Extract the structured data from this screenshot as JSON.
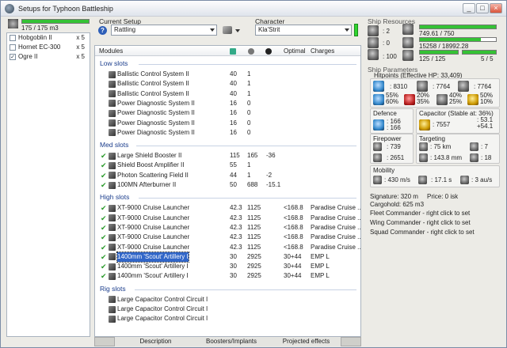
{
  "window": {
    "title": "Setups for Typhoon Battleship",
    "btn_min": "_",
    "btn_max": "□",
    "btn_close": "×"
  },
  "left": {
    "capacity": "175 / 175 m3",
    "capacity_fill": 1.0,
    "drones": [
      {
        "name": "Hobgoblin II",
        "qty": "x 5",
        "checked": false
      },
      {
        "name": "Hornet EC-300",
        "qty": "x 5",
        "checked": false
      },
      {
        "name": "Ogre II",
        "qty": "x 5",
        "checked": true
      }
    ]
  },
  "setup": {
    "label": "Current Setup",
    "value": "Rattling",
    "help": "?"
  },
  "character": {
    "label": "Character",
    "value": "Kla'Strit"
  },
  "table": {
    "headers": {
      "modules": "Modules",
      "optimal": "Optimal",
      "charges": "Charges"
    },
    "low_title": "Low slots",
    "med_title": "Med slots",
    "high_title": "High slots",
    "rig_title": "Rig slots",
    "low": [
      {
        "name": "Ballistic Control System II",
        "a": "40",
        "b": "1"
      },
      {
        "name": "Ballistic Control System II",
        "a": "40",
        "b": "1"
      },
      {
        "name": "Ballistic Control System II",
        "a": "40",
        "b": "1"
      },
      {
        "name": "Power Diagnostic System II",
        "a": "16",
        "b": "0"
      },
      {
        "name": "Power Diagnostic System II",
        "a": "16",
        "b": "0"
      },
      {
        "name": "Power Diagnostic System II",
        "a": "16",
        "b": "0"
      },
      {
        "name": "Power Diagnostic System II",
        "a": "16",
        "b": "0"
      }
    ],
    "med": [
      {
        "name": "Large Shield Booster II",
        "a": "115",
        "b": "165",
        "c": "-36",
        "chk": true
      },
      {
        "name": "Shield Boost Amplifier II",
        "a": "55",
        "b": "1",
        "c": "",
        "chk": true
      },
      {
        "name": "Photon Scattering Field II",
        "a": "44",
        "b": "1",
        "c": "-2",
        "chk": true
      },
      {
        "name": "100MN Afterburner II",
        "a": "50",
        "b": "688",
        "c": "-15.1",
        "chk": true
      }
    ],
    "high": [
      {
        "name": "XT-9000 Cruise Launcher",
        "a": "42.3",
        "b": "1125",
        "opt": "<168.8",
        "chg": "Paradise Cruise ..."
      },
      {
        "name": "XT-9000 Cruise Launcher",
        "a": "42.3",
        "b": "1125",
        "opt": "<168.8",
        "chg": "Paradise Cruise ..."
      },
      {
        "name": "XT-9000 Cruise Launcher",
        "a": "42.3",
        "b": "1125",
        "opt": "<168.8",
        "chg": "Paradise Cruise ..."
      },
      {
        "name": "XT-9000 Cruise Launcher",
        "a": "42.3",
        "b": "1125",
        "opt": "<168.8",
        "chg": "Paradise Cruise ..."
      },
      {
        "name": "XT-9000 Cruise Launcher",
        "a": "42.3",
        "b": "1125",
        "opt": "<168.8",
        "chg": "Paradise Cruise ..."
      },
      {
        "name": "1400mm 'Scout' Artillery I",
        "a": "30",
        "b": "2925",
        "opt": "30+44",
        "chg": "EMP L"
      },
      {
        "name": "1400mm 'Scout' Artillery I",
        "a": "30",
        "b": "2925",
        "opt": "30+44",
        "chg": "EMP L"
      },
      {
        "name": "1400mm 'Scout' Artillery I",
        "a": "30",
        "b": "2925",
        "opt": "30+44",
        "chg": "EMP L"
      }
    ],
    "rig": [
      {
        "name": "Large Capacitor Control Circuit I"
      },
      {
        "name": "Large Capacitor Control Circuit I"
      },
      {
        "name": "Large Capacitor Control Circuit I"
      }
    ]
  },
  "tabs": {
    "description": "Description",
    "boosters": "Boosters/Implants",
    "projected": "Projected effects"
  },
  "resources": {
    "title": "Ship Resources",
    "turrets": ": 2",
    "launchers": ": 0",
    "calib": ": 100",
    "cpu": "749.61 / 750",
    "cpu_fill": 0.999,
    "pg": "15258 / 18992.28",
    "pg_fill": 0.8,
    "bay": "125 / 125",
    "bay_fill": 1.0,
    "drones_out": "5 / 5",
    "drones_fill": 1.0
  },
  "params": {
    "title": "Ship Parameters",
    "hitpoints": "Hitpoints (Effective HP: 33,409)",
    "hp_shield": ": 8310",
    "hp_armor": ": 7764",
    "hp_hull": ": 7764",
    "res_em": "55%|60%",
    "res_th": "20%|35%",
    "res_kin": "40%|25%",
    "res_exp": "50%|10%",
    "defence": "Defence",
    "def_val": ": 166|: 166",
    "capacitor": "Capacitor (Stable at: 36%)",
    "cap_val": ": 7557",
    "cap_delta": ": 53.1|+54.1",
    "firepower": "Firepower",
    "fp_volley": ": 739",
    "fp_dps": ": 2651",
    "targeting": "Targeting",
    "tg_range": ": 75 km",
    "tg_targets": ": 7",
    "tg_sig": ": 143.8 mm",
    "tg_sensor": ": 18",
    "mobility": "Mobility",
    "mob_speed": ": 430 m/s",
    "mob_align": ": 17.1 s",
    "mob_warp": ": 3 au/s",
    "signature": "Signature: 320 m",
    "price": "Price: 0 isk",
    "cargohold": "Cargohold: 625 m3",
    "fleet": "Fleet Commander - right click to set",
    "wing": "Wing Commander - right click to set",
    "squad": "Squad Commander - right click to set"
  }
}
